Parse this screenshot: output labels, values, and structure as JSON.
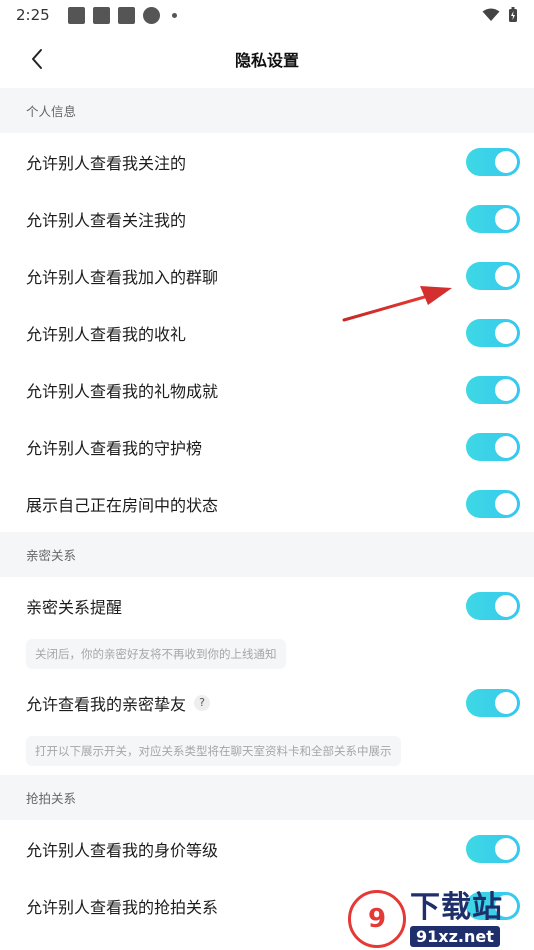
{
  "status_bar": {
    "time": "2:25"
  },
  "nav": {
    "title": "隐私设置"
  },
  "sections": {
    "personal": {
      "header": "个人信息",
      "items": [
        "允许别人查看我关注的",
        "允许别人查看关注我的",
        "允许别人查看我加入的群聊",
        "允许别人查看我的收礼",
        "允许别人查看我的礼物成就",
        "允许别人查看我的守护榜",
        "展示自己正在房间中的状态"
      ]
    },
    "intimate": {
      "header": "亲密关系",
      "remind_label": "亲密关系提醒",
      "remind_hint": "关闭后，你的亲密好友将不再收到你的上线通知",
      "view_label": "允许查看我的亲密挚友",
      "help_symbol": "?",
      "view_hint": "打开以下展示开关，对应关系类型将在聊天室资料卡和全部关系中展示"
    },
    "grab": {
      "header": "抢拍关系",
      "items": [
        "允许别人查看我的身价等级",
        "允许别人查看我的抢拍关系"
      ]
    }
  },
  "toggles_on": true,
  "colors": {
    "accent_start": "#3ed8e4",
    "accent_end": "#36c8f0",
    "annotation_arrow": "#d32f2f"
  },
  "watermark": {
    "logo": "9",
    "title": "下载站",
    "url": "91xz.net"
  }
}
